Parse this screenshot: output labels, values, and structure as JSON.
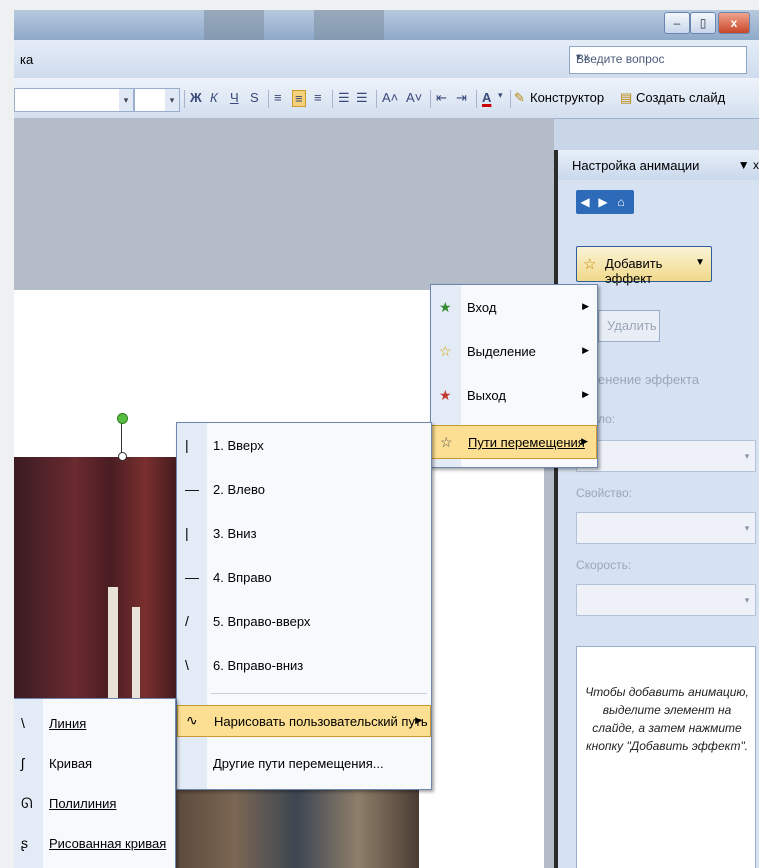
{
  "window": {
    "minimize": "–",
    "restore": "▯",
    "close": "x"
  },
  "menu_fragment": "ка",
  "question_box": {
    "placeholder": "Введите вопрос",
    "arrow": "▾ x"
  },
  "toolbar": {
    "bold": "Ж",
    "italic": "К",
    "underline": "Ч",
    "shadow": "S",
    "grow": "A˄",
    "shrink": "A˅",
    "font_color": "A",
    "constructor_label": "Конструктор",
    "new_slide_label": "Создать слайд"
  },
  "task_pane": {
    "title": "Настройка анимации",
    "controls": "▼ x",
    "nav": [
      "◀",
      "▶",
      "⌂"
    ],
    "add_effect": "Добавить эффект",
    "delete": "Удалить",
    "change_effect": "енение эффекта",
    "start_label": "ло:",
    "property_label": "Свойство:",
    "speed_label": "Скорость:",
    "hint": "Чтобы добавить анимацию, выделите элемент на слайде, а затем нажмите кнопку \"Добавить эффект\"."
  },
  "effect_menu": [
    {
      "icon": "★",
      "label": "Вход",
      "color": "#2e8b2e"
    },
    {
      "icon": "☆",
      "label": "Выделение",
      "color": "#d6a400"
    },
    {
      "icon": "★",
      "label": "Выход",
      "color": "#c0392b"
    },
    {
      "icon": "☆",
      "label": "Пути перемещения",
      "color": "#555555"
    }
  ],
  "paths_menu": [
    {
      "icon": "|",
      "label": "1. Вверх"
    },
    {
      "icon": "—",
      "label": "2. Влево"
    },
    {
      "icon": "|",
      "label": "3. Вниз"
    },
    {
      "icon": "—",
      "label": "4. Вправо"
    },
    {
      "icon": "/",
      "label": "5. Вправо-вверх"
    },
    {
      "icon": "\\",
      "label": "6. Вправо-вниз"
    },
    {
      "icon": "∿",
      "label": "Нарисовать пользовательский путь"
    },
    {
      "icon": "",
      "label": "Другие пути перемещения..."
    }
  ],
  "draw_menu": [
    {
      "icon": "\\",
      "label": "Линия"
    },
    {
      "icon": "ʃ",
      "label": "Кривая"
    },
    {
      "icon": "ᘏ",
      "label": "Полилиния"
    },
    {
      "icon": "ʂ",
      "label": "Рисованная кривая"
    }
  ]
}
